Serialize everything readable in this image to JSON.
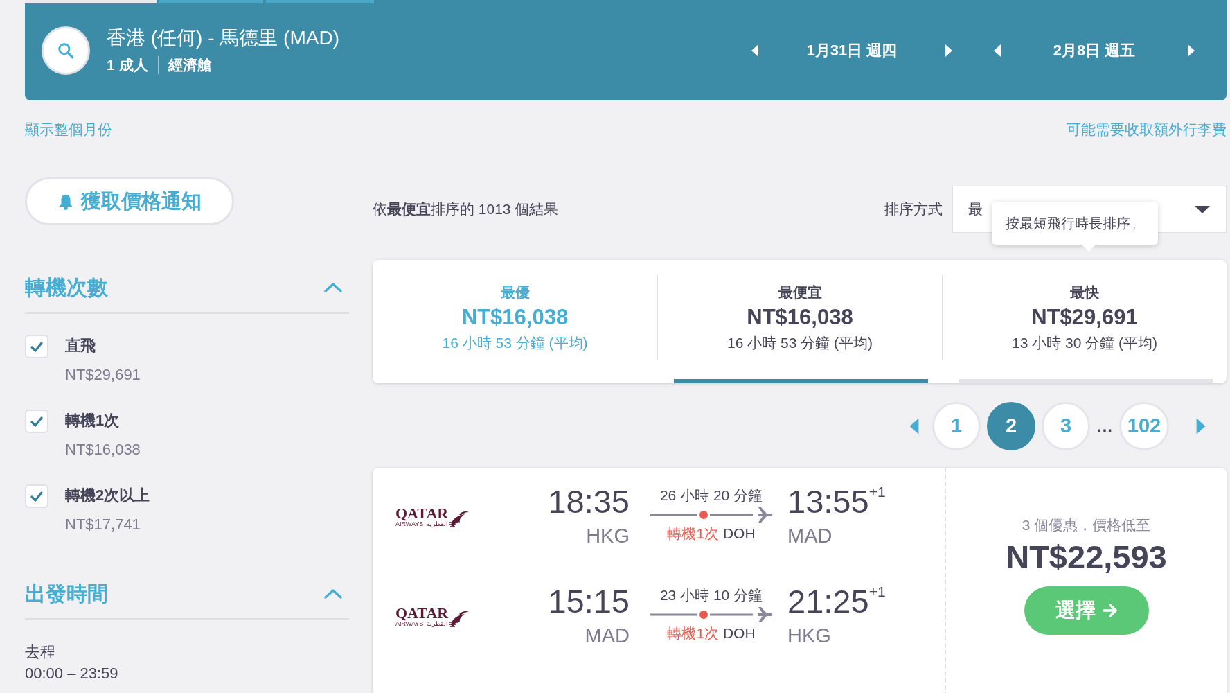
{
  "header": {
    "route": "香港 (任何) - 馬德里 (MAD)",
    "passengers": "1 成人",
    "cabin": "經濟艙",
    "dates": [
      {
        "label": "1月31日 週四"
      },
      {
        "label": "2月8日 週五"
      }
    ]
  },
  "links": {
    "month": "顯示整個月份",
    "baggage": "可能需要收取額外行李費"
  },
  "sidebar": {
    "alert_button": "獲取價格通知",
    "stops_section": {
      "title": "轉機次數",
      "expanded": true,
      "options": [
        {
          "label": "直飛",
          "price": "NT$29,691",
          "checked": true
        },
        {
          "label": "轉機1次",
          "price": "NT$16,038",
          "checked": true
        },
        {
          "label": "轉機2次以上",
          "price": "NT$17,741",
          "checked": true
        }
      ]
    },
    "time_section": {
      "title": "出發時間",
      "expanded": true,
      "ranges": [
        {
          "label": "去程",
          "value": "00:00 – 23:59"
        }
      ]
    }
  },
  "results": {
    "summary": "依**最便宜**排序的 1013 個結果",
    "sort_label": "排序方式",
    "sort_value": "最",
    "tooltip": "按最短飛行時長排序。",
    "tabs": [
      {
        "kind": "best",
        "title": "最優",
        "price": "NT$16,038",
        "duration": "16 小時 53 分鐘 (平均)",
        "selected": false,
        "hovered": false
      },
      {
        "kind": "plain",
        "title": "最便宜",
        "price": "NT$16,038",
        "duration": "16 小時 53 分鐘 (平均)",
        "selected": true,
        "hovered": false
      },
      {
        "kind": "plain",
        "title": "最快",
        "price": "NT$29,691",
        "duration": "13 小時 30 分鐘 (平均)",
        "selected": false,
        "hovered": true
      }
    ],
    "pages": [
      {
        "kind": "page",
        "label": "1",
        "selected": false
      },
      {
        "kind": "page",
        "label": "2",
        "selected": true
      },
      {
        "kind": "page",
        "label": "3",
        "selected": false
      },
      {
        "kind": "ellipsis",
        "label": "…"
      },
      {
        "kind": "page",
        "label": "102",
        "selected": false
      }
    ],
    "flights": [
      {
        "deal_text": "3 個優惠，價格低至",
        "price": "NT$22,593",
        "button": "選擇",
        "legs": [
          {
            "airline": "QATAR",
            "airline_sub": "AIRWAYS",
            "airline_arabic": "القطرية",
            "depart_time": "18:35",
            "depart_code": "HKG",
            "duration": "26 小時 20 分鐘",
            "stops": "轉機1次",
            "via": "DOH",
            "arrive_time": "13:55",
            "day_offset": "+1",
            "arrive_code": "MAD"
          },
          {
            "airline": "QATAR",
            "airline_sub": "AIRWAYS",
            "airline_arabic": "القطرية",
            "depart_time": "15:15",
            "depart_code": "MAD",
            "duration": "23 小時 10 分鐘",
            "stops": "轉機1次",
            "via": "DOH",
            "arrive_time": "21:25",
            "day_offset": "+1",
            "arrive_code": "HKG"
          }
        ]
      }
    ]
  }
}
